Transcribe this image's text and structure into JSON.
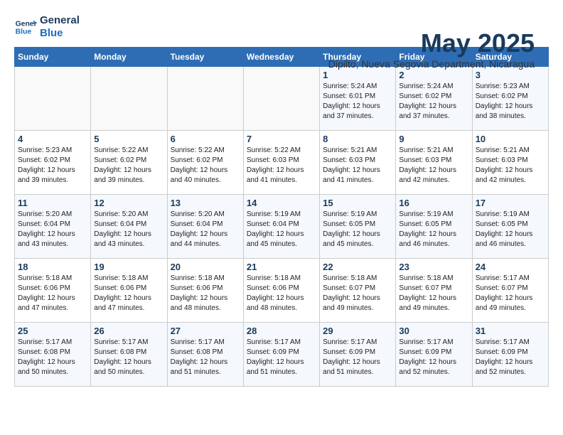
{
  "logo": {
    "text_general": "General",
    "text_blue": "Blue"
  },
  "header": {
    "month": "May 2025",
    "location": "Dipilto, Nueva Segovia Department, Nicaragua"
  },
  "weekdays": [
    "Sunday",
    "Monday",
    "Tuesday",
    "Wednesday",
    "Thursday",
    "Friday",
    "Saturday"
  ],
  "weeks": [
    [
      {
        "day": "",
        "info": ""
      },
      {
        "day": "",
        "info": ""
      },
      {
        "day": "",
        "info": ""
      },
      {
        "day": "",
        "info": ""
      },
      {
        "day": "1",
        "info": "Sunrise: 5:24 AM\nSunset: 6:01 PM\nDaylight: 12 hours\nand 37 minutes."
      },
      {
        "day": "2",
        "info": "Sunrise: 5:24 AM\nSunset: 6:02 PM\nDaylight: 12 hours\nand 37 minutes."
      },
      {
        "day": "3",
        "info": "Sunrise: 5:23 AM\nSunset: 6:02 PM\nDaylight: 12 hours\nand 38 minutes."
      }
    ],
    [
      {
        "day": "4",
        "info": "Sunrise: 5:23 AM\nSunset: 6:02 PM\nDaylight: 12 hours\nand 39 minutes."
      },
      {
        "day": "5",
        "info": "Sunrise: 5:22 AM\nSunset: 6:02 PM\nDaylight: 12 hours\nand 39 minutes."
      },
      {
        "day": "6",
        "info": "Sunrise: 5:22 AM\nSunset: 6:02 PM\nDaylight: 12 hours\nand 40 minutes."
      },
      {
        "day": "7",
        "info": "Sunrise: 5:22 AM\nSunset: 6:03 PM\nDaylight: 12 hours\nand 41 minutes."
      },
      {
        "day": "8",
        "info": "Sunrise: 5:21 AM\nSunset: 6:03 PM\nDaylight: 12 hours\nand 41 minutes."
      },
      {
        "day": "9",
        "info": "Sunrise: 5:21 AM\nSunset: 6:03 PM\nDaylight: 12 hours\nand 42 minutes."
      },
      {
        "day": "10",
        "info": "Sunrise: 5:21 AM\nSunset: 6:03 PM\nDaylight: 12 hours\nand 42 minutes."
      }
    ],
    [
      {
        "day": "11",
        "info": "Sunrise: 5:20 AM\nSunset: 6:04 PM\nDaylight: 12 hours\nand 43 minutes."
      },
      {
        "day": "12",
        "info": "Sunrise: 5:20 AM\nSunset: 6:04 PM\nDaylight: 12 hours\nand 43 minutes."
      },
      {
        "day": "13",
        "info": "Sunrise: 5:20 AM\nSunset: 6:04 PM\nDaylight: 12 hours\nand 44 minutes."
      },
      {
        "day": "14",
        "info": "Sunrise: 5:19 AM\nSunset: 6:04 PM\nDaylight: 12 hours\nand 45 minutes."
      },
      {
        "day": "15",
        "info": "Sunrise: 5:19 AM\nSunset: 6:05 PM\nDaylight: 12 hours\nand 45 minutes."
      },
      {
        "day": "16",
        "info": "Sunrise: 5:19 AM\nSunset: 6:05 PM\nDaylight: 12 hours\nand 46 minutes."
      },
      {
        "day": "17",
        "info": "Sunrise: 5:19 AM\nSunset: 6:05 PM\nDaylight: 12 hours\nand 46 minutes."
      }
    ],
    [
      {
        "day": "18",
        "info": "Sunrise: 5:18 AM\nSunset: 6:06 PM\nDaylight: 12 hours\nand 47 minutes."
      },
      {
        "day": "19",
        "info": "Sunrise: 5:18 AM\nSunset: 6:06 PM\nDaylight: 12 hours\nand 47 minutes."
      },
      {
        "day": "20",
        "info": "Sunrise: 5:18 AM\nSunset: 6:06 PM\nDaylight: 12 hours\nand 48 minutes."
      },
      {
        "day": "21",
        "info": "Sunrise: 5:18 AM\nSunset: 6:06 PM\nDaylight: 12 hours\nand 48 minutes."
      },
      {
        "day": "22",
        "info": "Sunrise: 5:18 AM\nSunset: 6:07 PM\nDaylight: 12 hours\nand 49 minutes."
      },
      {
        "day": "23",
        "info": "Sunrise: 5:18 AM\nSunset: 6:07 PM\nDaylight: 12 hours\nand 49 minutes."
      },
      {
        "day": "24",
        "info": "Sunrise: 5:17 AM\nSunset: 6:07 PM\nDaylight: 12 hours\nand 49 minutes."
      }
    ],
    [
      {
        "day": "25",
        "info": "Sunrise: 5:17 AM\nSunset: 6:08 PM\nDaylight: 12 hours\nand 50 minutes."
      },
      {
        "day": "26",
        "info": "Sunrise: 5:17 AM\nSunset: 6:08 PM\nDaylight: 12 hours\nand 50 minutes."
      },
      {
        "day": "27",
        "info": "Sunrise: 5:17 AM\nSunset: 6:08 PM\nDaylight: 12 hours\nand 51 minutes."
      },
      {
        "day": "28",
        "info": "Sunrise: 5:17 AM\nSunset: 6:09 PM\nDaylight: 12 hours\nand 51 minutes."
      },
      {
        "day": "29",
        "info": "Sunrise: 5:17 AM\nSunset: 6:09 PM\nDaylight: 12 hours\nand 51 minutes."
      },
      {
        "day": "30",
        "info": "Sunrise: 5:17 AM\nSunset: 6:09 PM\nDaylight: 12 hours\nand 52 minutes."
      },
      {
        "day": "31",
        "info": "Sunrise: 5:17 AM\nSunset: 6:09 PM\nDaylight: 12 hours\nand 52 minutes."
      }
    ]
  ]
}
